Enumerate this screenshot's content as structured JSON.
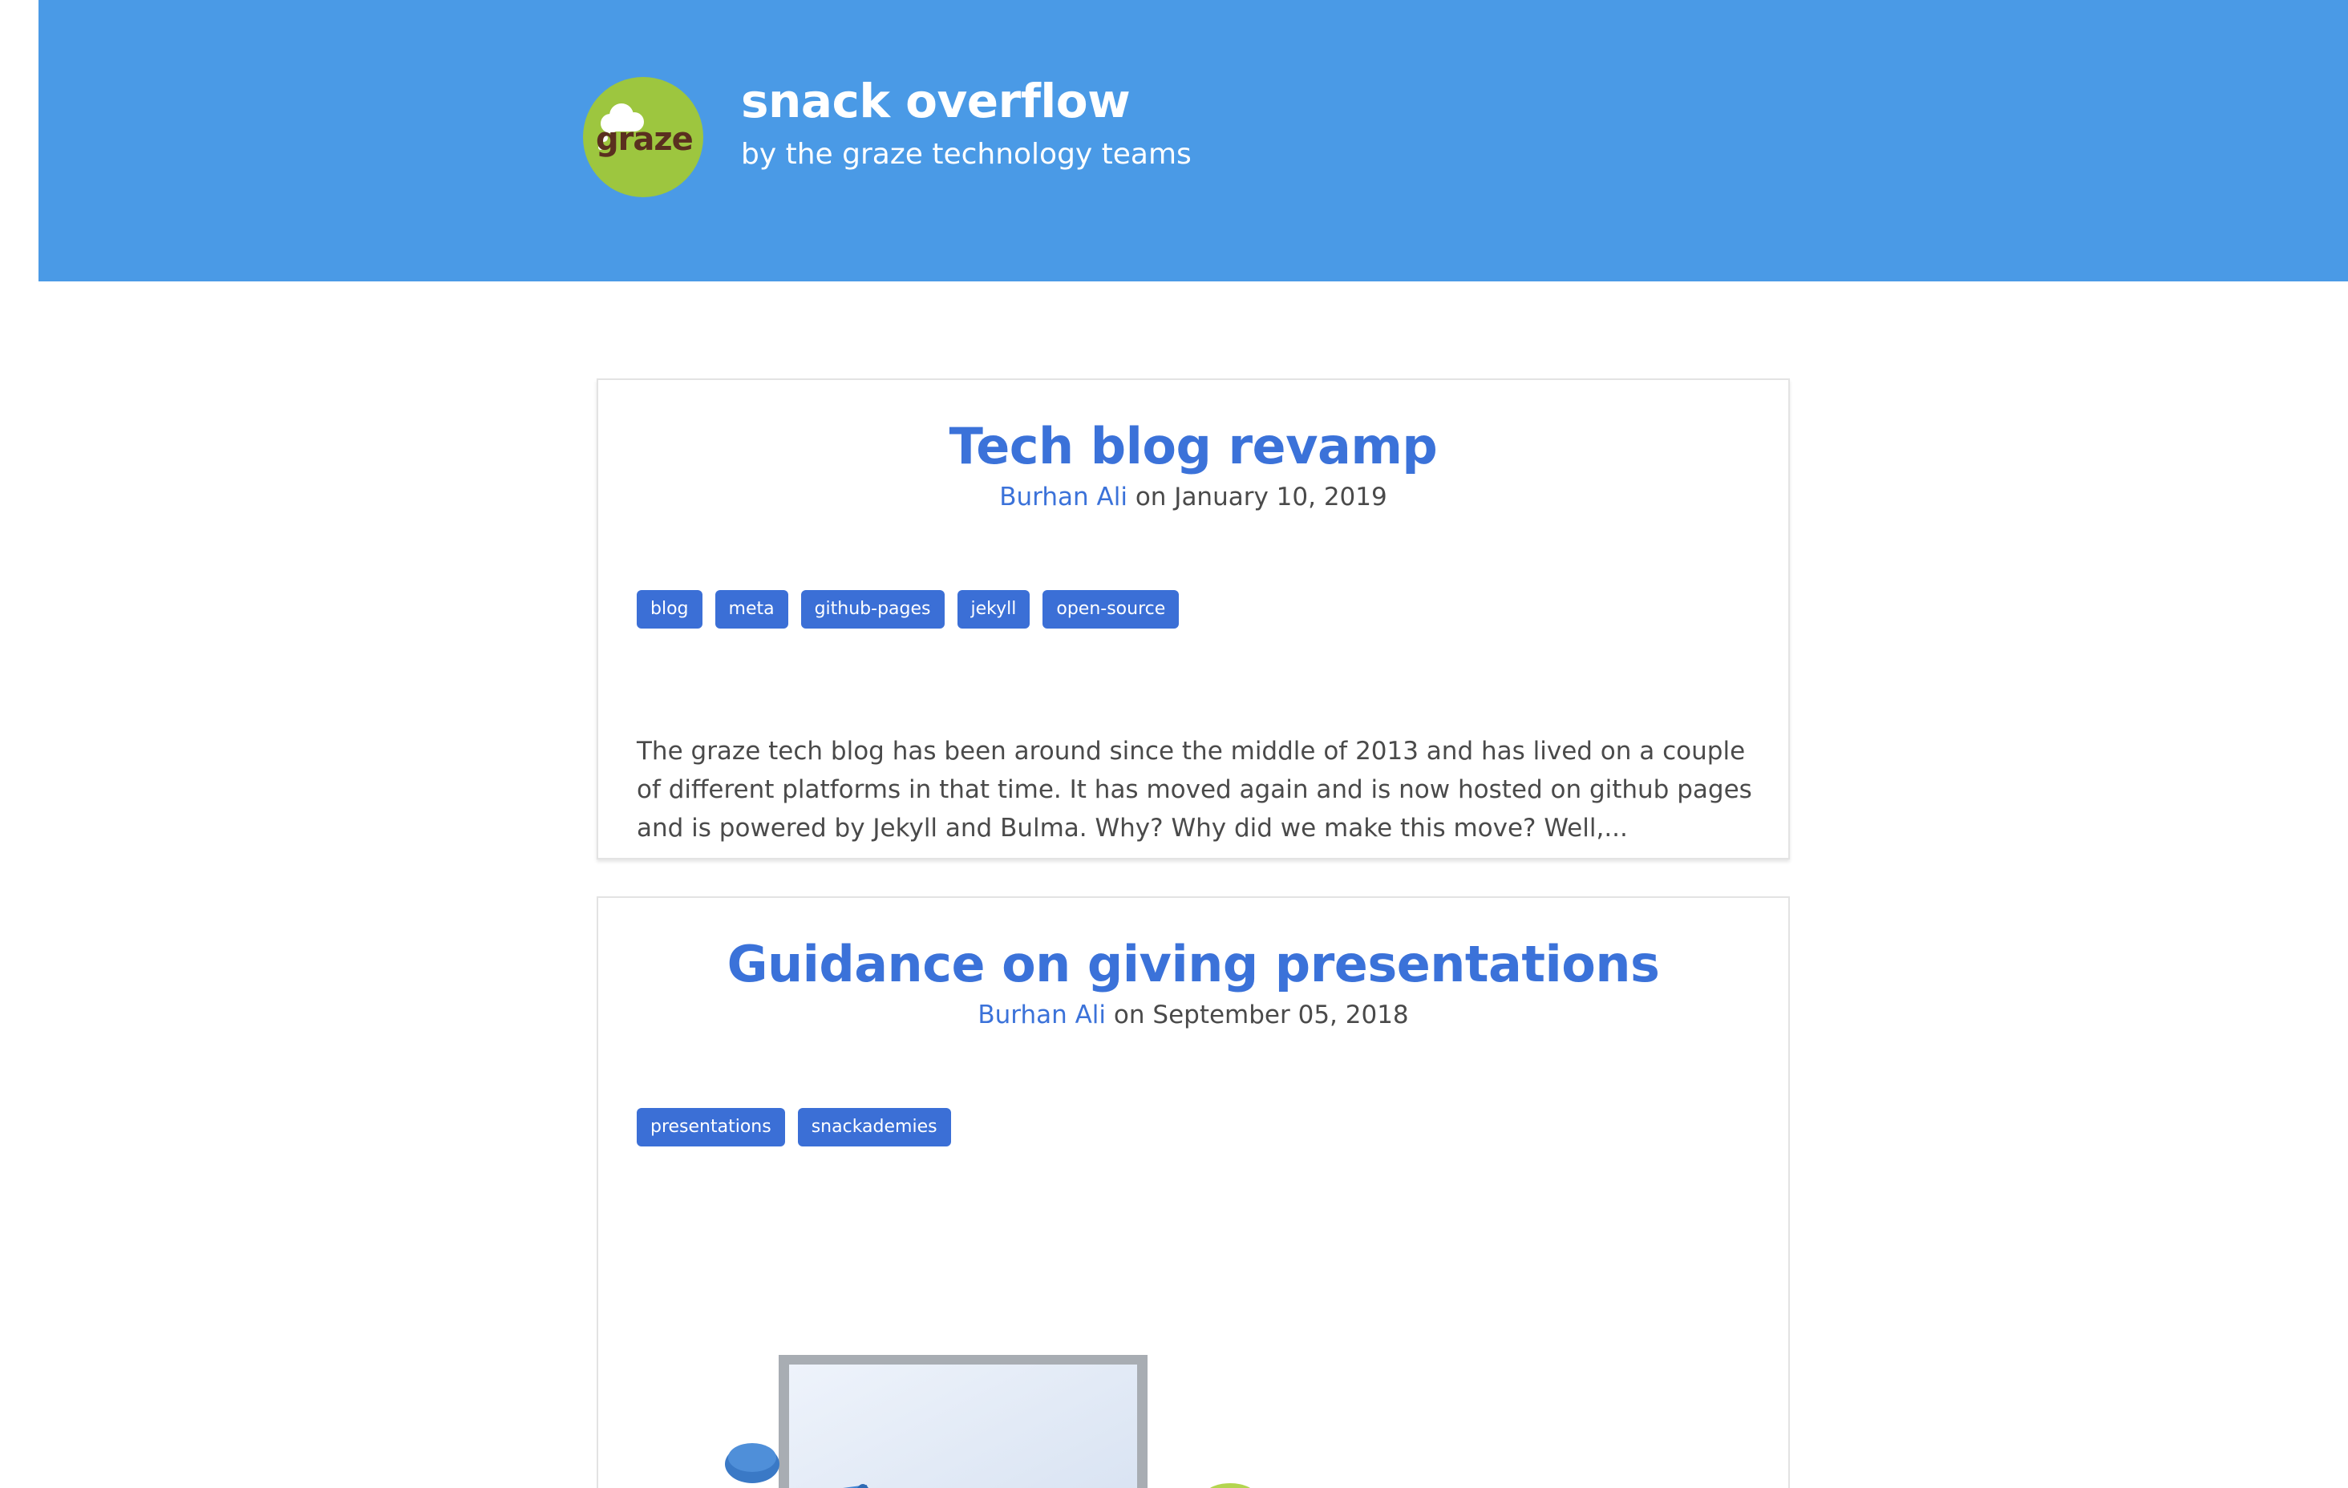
{
  "site": {
    "title": "snack overflow",
    "subtitle": "by the graze technology teams",
    "logo_text": "graze",
    "brand_color": "#4a9ae6",
    "logo_color": "#9dc63f"
  },
  "posts": [
    {
      "title": "Tech blog revamp",
      "author": "Burhan Ali",
      "date_prefix": "on",
      "date": "January 10, 2019",
      "tags": [
        "blog",
        "meta",
        "github-pages",
        "jekyll",
        "open-source"
      ],
      "excerpt": "The graze tech blog has been around since the middle of 2013 and has lived on a couple of different platforms in that time. It has moved again and is now hosted on github pages and is powered by Jekyll and Bulma. Why? Why did we make this move? Well,..."
    },
    {
      "title": "Guidance on giving presentations",
      "author": "Burhan Ali",
      "date_prefix": "on",
      "date": "September 05, 2018",
      "tags": [
        "presentations",
        "snackademies"
      ],
      "image_icon": "presentation-illustration-icon"
    }
  ],
  "colors": {
    "link": "#3b72d9",
    "tag_bg": "#3b6fd6",
    "text": "#4a4a4a"
  }
}
